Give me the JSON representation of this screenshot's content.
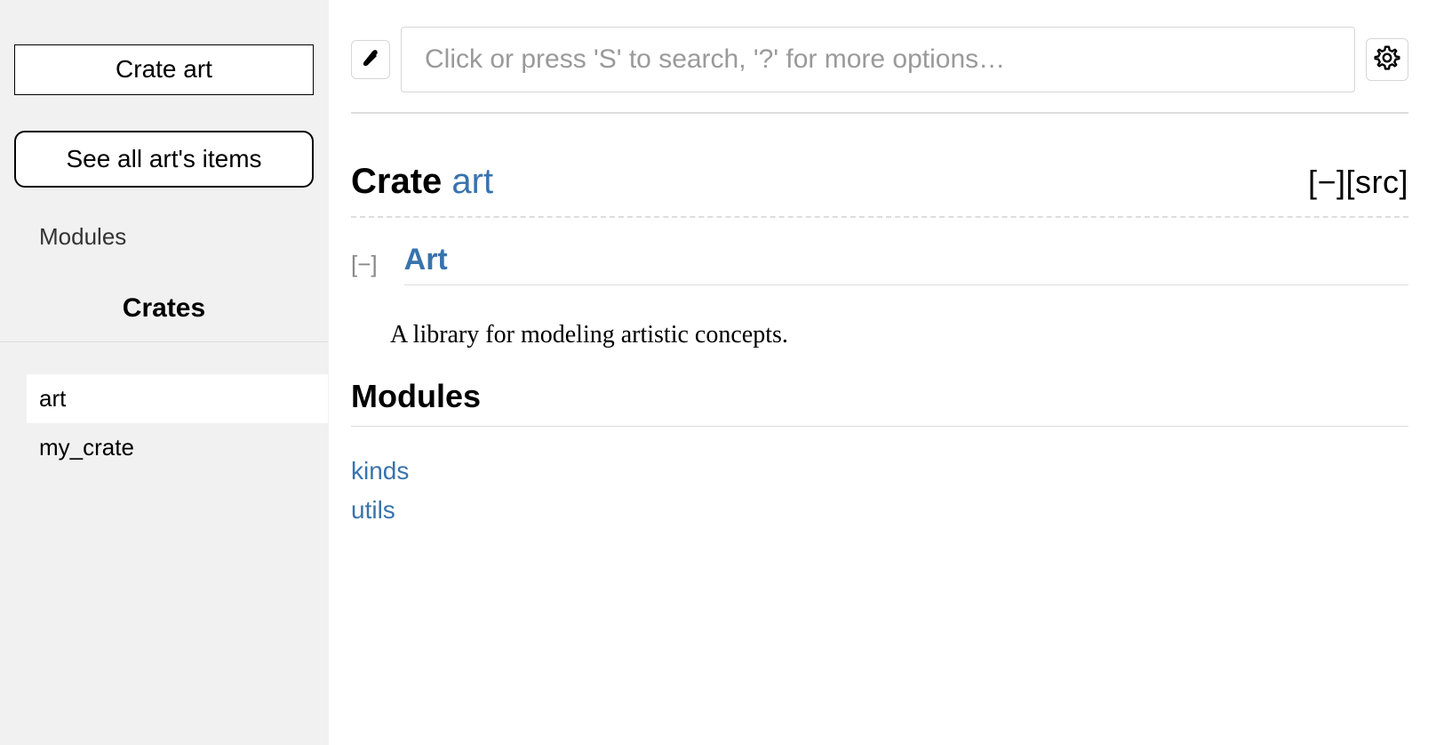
{
  "sidebar": {
    "location": "Crate art",
    "all_items_label": "See all art's items",
    "section_label": "Modules",
    "crates_heading": "Crates",
    "crates": [
      {
        "name": "art",
        "active": true
      },
      {
        "name": "my_crate",
        "active": false
      }
    ]
  },
  "search": {
    "placeholder": "Click or press 'S' to search, '?' for more options…"
  },
  "heading": {
    "prefix": "Crate ",
    "name": "art",
    "collapse": "[−]",
    "src": "[src]"
  },
  "doc": {
    "collapse": "[−]",
    "title": "Art",
    "description": "A library for modeling artistic concepts."
  },
  "modules_section": {
    "heading": "Modules",
    "items": [
      "kinds",
      "utils"
    ]
  }
}
